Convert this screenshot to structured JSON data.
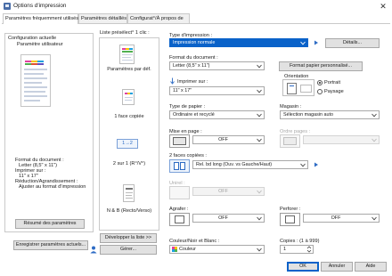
{
  "window": {
    "title": "Options d'impression"
  },
  "tabs": [
    "Paramètres fréquemment utilisés",
    "Paramètres détaillés",
    "Configurat°/À propos de"
  ],
  "current_config": {
    "group_title": "Configuration actuelle",
    "name": "Paramètre utilisateur",
    "doc_format_label": "Format du document :",
    "doc_format_value": "Letter (8,5\" x 11\")",
    "print_on_label": "Imprimer sur :",
    "print_on_value": "11\" x 17\"",
    "reduction_label": "Réduction/Agrandissement :",
    "reduction_value": "Ajuster au format d'impression",
    "summary_button": "Résumé des paramètres"
  },
  "presets": {
    "title": "Liste présélect° 1 clic :",
    "items": [
      "Paramètres par déf.",
      "1 face copiée",
      "2 sur 1 (R°/V°)",
      "N & B (Recto/Verso)"
    ],
    "duplex_glyph": "1→2",
    "expand_button": "Développer la liste >>",
    "manage_button": "Gérer...",
    "save_button": "Enregistrer paramètres actuels..."
  },
  "settings": {
    "print_type_label": "Type d'impression :",
    "print_type_value": "Impression normale",
    "details_button": "Détails...",
    "doc_size_label": "Format du document :",
    "doc_size_value": "Letter (8,5\" x 11\")",
    "custom_size_button": "Format papier personnalisé...",
    "print_on_label": "Imprimer sur :",
    "print_on_value": "11\" x 17\"",
    "orientation_label": "Orientation",
    "orientation_options": [
      "Portrait",
      "Paysage"
    ],
    "paper_type_label": "Type de papier :",
    "paper_type_value": "Ordinaire et recyclé",
    "tray_label": "Magasin :",
    "tray_value": "Sélection magasin auto",
    "layout_label": "Mise en page :",
    "layout_value": "OFF",
    "page_order_label": "Ordre pages :",
    "duplex_label": "2 faces copiées :",
    "duplex_value": "Rel. bd long (Ouv. vs Gauche/Haut)",
    "staple_label": "Unirel :",
    "staple_value": "OFF",
    "staple_label2": "Agrafer :",
    "staple_value2": "OFF",
    "punch_label": "Perforer :",
    "punch_value": "OFF",
    "color_label": "Couleur/Noir et Blanc :",
    "color_value": "Couleur",
    "copies_label": "Copies : (1 à 999)",
    "copies_value": "1"
  },
  "footer": {
    "ok": "OK",
    "cancel": "Annuler",
    "help": "Aide"
  },
  "colors": {
    "accent": "#0a62c9",
    "border": "#c9c9c9"
  }
}
